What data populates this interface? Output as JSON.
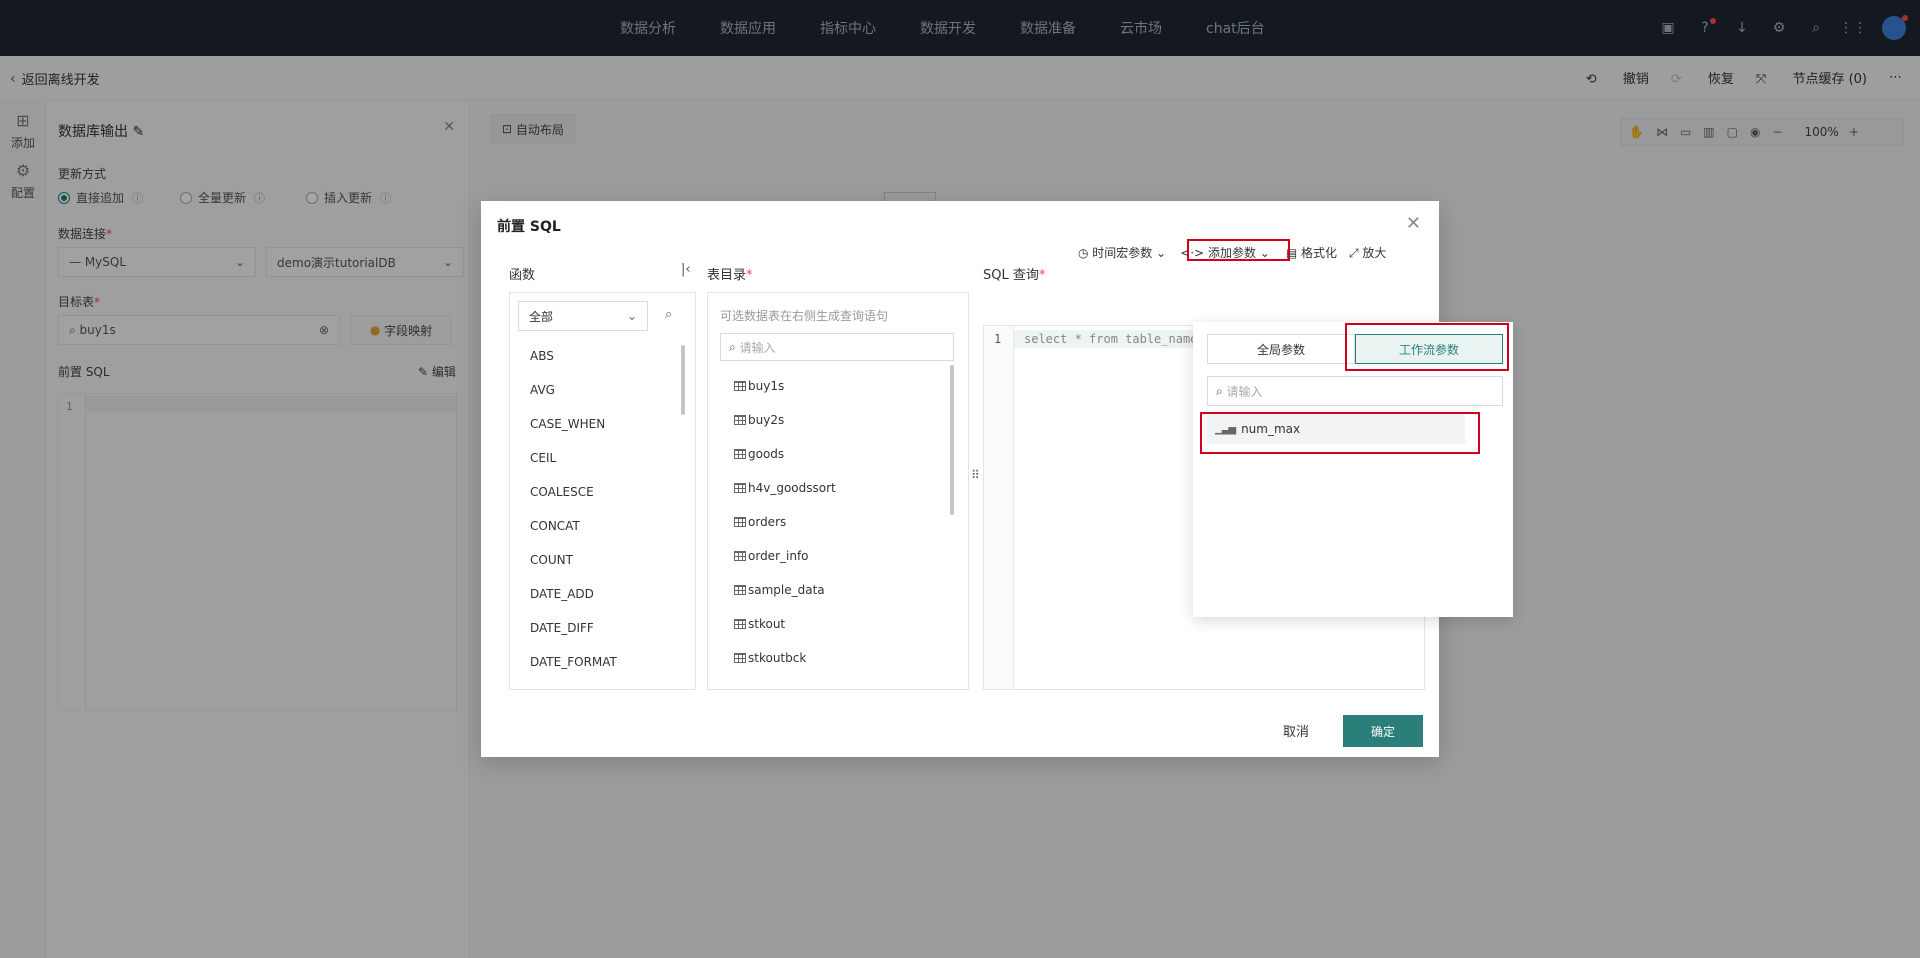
{
  "topnav": {
    "menu": [
      "数据分析",
      "数据应用",
      "指标中心",
      "数据开发",
      "数据准备",
      "云市场",
      "chat后台"
    ]
  },
  "subbar": {
    "back_label": "返回离线开发",
    "undo": "撤销",
    "redo": "恢复",
    "node_cache": "节点缓存 (0)"
  },
  "rail": {
    "add": "添加",
    "config": "配置"
  },
  "panel": {
    "title": "数据库输出",
    "update_mode_label": "更新方式",
    "modes": [
      "直接追加",
      "全量更新",
      "插入更新"
    ],
    "connection_label": "数据连接",
    "connection_type": "MySQL",
    "connection_db": "demo演示tutorialDB",
    "target_label": "目标表",
    "target_value": "buy1s",
    "field_mapping": "字段映射",
    "pre_sql_label": "前置 SQL",
    "edit": "编辑",
    "line1": "1"
  },
  "canvas": {
    "auto_layout": "自动布局",
    "zoom": "100%"
  },
  "modal": {
    "title": "前置 SQL",
    "functions_label": "函数",
    "function_filter": "全部",
    "functions": [
      "ABS",
      "AVG",
      "CASE_WHEN",
      "CEIL",
      "COALESCE",
      "CONCAT",
      "COUNT",
      "DATE_ADD",
      "DATE_DIFF",
      "DATE_FORMAT"
    ],
    "tables_label": "表目录",
    "tables_hint": "可选数据表在右侧生成查询语句",
    "tables_search_placeholder": "请输入",
    "tables": [
      "buy1s",
      "buy2s",
      "goods",
      "h4v_goodssort",
      "orders",
      "order_info",
      "sample_data",
      "stkout",
      "stkoutbck"
    ],
    "sql_label": "SQL 查询",
    "time_macro": "时间宏参数",
    "add_param": "添加参数",
    "format": "格式化",
    "enlarge": "放大",
    "sql_line_no": "1",
    "sql_text": "select * from table_name",
    "cancel": "取消",
    "confirm": "确定"
  },
  "param_dropdown": {
    "tab_global": "全局参数",
    "tab_workflow": "工作流参数",
    "search_placeholder": "请输入",
    "items": [
      "num_max"
    ]
  }
}
